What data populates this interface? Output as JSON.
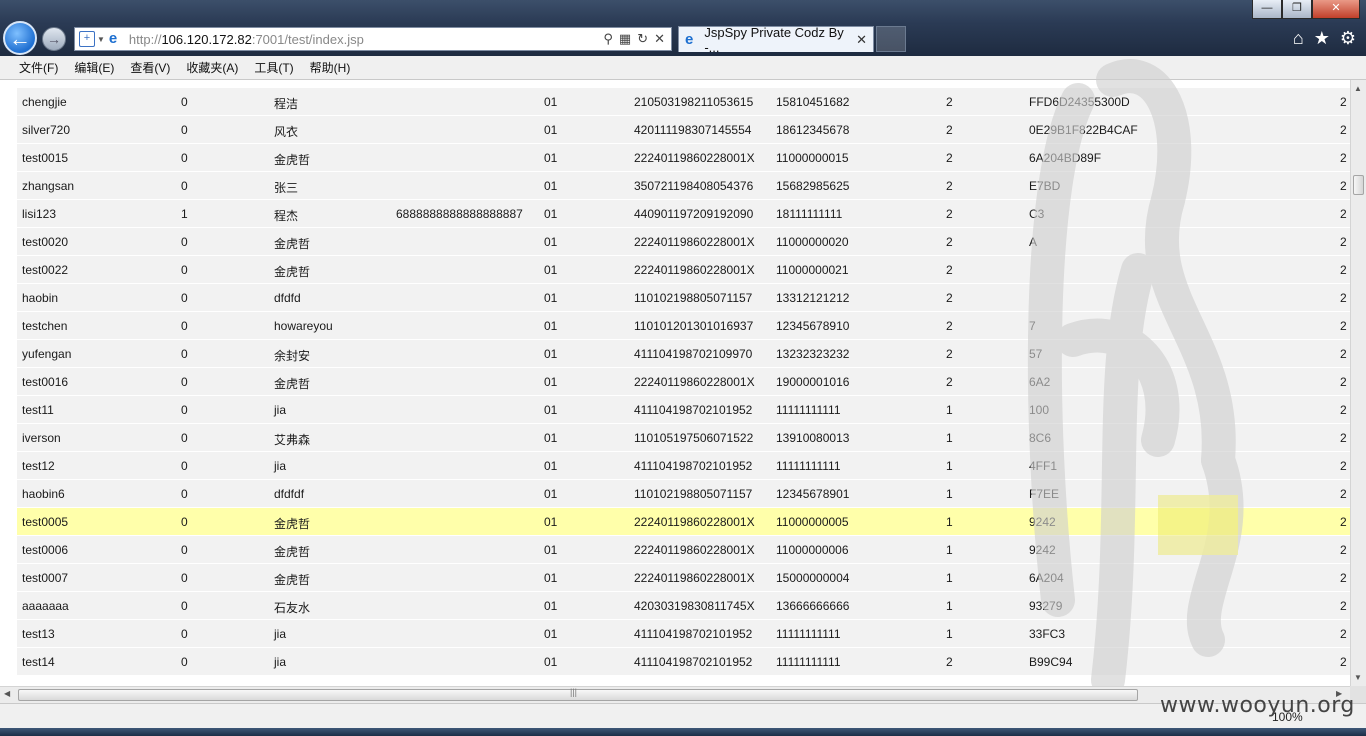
{
  "window": {
    "minimize_label": "—",
    "maximize_label": "❐",
    "close_label": "✕"
  },
  "address_bar": {
    "url_prefix": "http://",
    "url_host": "106.120.172.82",
    "url_rest": ":7001/test/index.jsp"
  },
  "tab": {
    "title": "JspSpy Private Codz By -..."
  },
  "menu": [
    "文件(F)",
    "编辑(E)",
    "查看(V)",
    "收藏夹(A)",
    "工具(T)",
    "帮助(H)"
  ],
  "table": {
    "rows": [
      {
        "user": "chengjie",
        "flag": "0",
        "name": "程洁",
        "extra": "",
        "code": "01",
        "id": "210503198211053615",
        "phone": "15810451682",
        "num": "2",
        "hash": "FFD6D24355300D",
        "last": "2"
      },
      {
        "user": "silver720",
        "flag": "0",
        "name": "风衣",
        "extra": "",
        "code": "01",
        "id": "420111198307145554",
        "phone": "18612345678",
        "num": "2",
        "hash": "0E29B1F822B4CAF",
        "last": "2"
      },
      {
        "user": "test0015",
        "flag": "0",
        "name": "金虎哲",
        "extra": "",
        "code": "01",
        "id": "22240119860228001X",
        "phone": "11000000015",
        "num": "2",
        "hash": "6A204BD89F",
        "last": "2"
      },
      {
        "user": "zhangsan",
        "flag": "0",
        "name": "张三",
        "extra": "",
        "code": "01",
        "id": "350721198408054376",
        "phone": "15682985625",
        "num": "2",
        "hash": "E7BD",
        "last": "2"
      },
      {
        "user": "lisi123",
        "flag": "1",
        "name": "程杰",
        "extra": "6888888888888888887",
        "code": "01",
        "id": "440901197209192090",
        "phone": "18111111111",
        "num": "2",
        "hash": "C3",
        "last": "2"
      },
      {
        "user": "test0020",
        "flag": "0",
        "name": "金虎哲",
        "extra": "",
        "code": "01",
        "id": "22240119860228001X",
        "phone": "11000000020",
        "num": "2",
        "hash": "A",
        "last": "2"
      },
      {
        "user": "test0022",
        "flag": "0",
        "name": "金虎哲",
        "extra": "",
        "code": "01",
        "id": "22240119860228001X",
        "phone": "11000000021",
        "num": "2",
        "hash": "",
        "last": "2"
      },
      {
        "user": "haobin",
        "flag": "0",
        "name": "dfdfd",
        "extra": "",
        "code": "01",
        "id": "110102198805071157",
        "phone": "13312121212",
        "num": "2",
        "hash": "",
        "last": "2"
      },
      {
        "user": "testchen",
        "flag": "0",
        "name": "howareyou",
        "extra": "",
        "code": "01",
        "id": "110101201301016937",
        "phone": "12345678910",
        "num": "2",
        "hash": "7",
        "last": "2"
      },
      {
        "user": "yufengan",
        "flag": "0",
        "name": "余封安",
        "extra": "",
        "code": "01",
        "id": "411104198702109970",
        "phone": "13232323232",
        "num": "2",
        "hash": "57",
        "last": "2"
      },
      {
        "user": "test0016",
        "flag": "0",
        "name": "金虎哲",
        "extra": "",
        "code": "01",
        "id": "22240119860228001X",
        "phone": "19000001016",
        "num": "2",
        "hash": "6A2",
        "last": "2"
      },
      {
        "user": "test11",
        "flag": "0",
        "name": "jia",
        "extra": "",
        "code": "01",
        "id": "411104198702101952",
        "phone": "11111111111",
        "num": "1",
        "hash": "100",
        "last": "2"
      },
      {
        "user": "iverson",
        "flag": "0",
        "name": "艾弗森",
        "extra": "",
        "code": "01",
        "id": "110105197506071522",
        "phone": "13910080013",
        "num": "1",
        "hash": "8C6",
        "last": "2"
      },
      {
        "user": "test12",
        "flag": "0",
        "name": "jia",
        "extra": "",
        "code": "01",
        "id": "411104198702101952",
        "phone": "11111111111",
        "num": "1",
        "hash": "4FF1",
        "last": "2"
      },
      {
        "user": "haobin6",
        "flag": "0",
        "name": "dfdfdf",
        "extra": "",
        "code": "01",
        "id": "110102198805071157",
        "phone": "12345678901",
        "num": "1",
        "hash": "F7EE",
        "last": "2"
      },
      {
        "user": "test0005",
        "flag": "0",
        "name": "金虎哲",
        "extra": "",
        "code": "01",
        "id": "22240119860228001X",
        "phone": "11000000005",
        "num": "1",
        "hash": "9242",
        "last": "2"
      },
      {
        "user": "test0006",
        "flag": "0",
        "name": "金虎哲",
        "extra": "",
        "code": "01",
        "id": "22240119860228001X",
        "phone": "11000000006",
        "num": "1",
        "hash": "9242",
        "last": "2"
      },
      {
        "user": "test0007",
        "flag": "0",
        "name": "金虎哲",
        "extra": "",
        "code": "01",
        "id": "22240119860228001X",
        "phone": "15000000004",
        "num": "1",
        "hash": "6A204",
        "last": "2"
      },
      {
        "user": "aaaaaaa",
        "flag": "0",
        "name": "石友水",
        "extra": "",
        "code": "01",
        "id": "42030319830811745X",
        "phone": "13666666666",
        "num": "1",
        "hash": "93279",
        "last": "2"
      },
      {
        "user": "test13",
        "flag": "0",
        "name": "jia",
        "extra": "",
        "code": "01",
        "id": "411104198702101952",
        "phone": "11111111111",
        "num": "1",
        "hash": "33FC3",
        "last": "2"
      },
      {
        "user": "test14",
        "flag": "0",
        "name": "jia",
        "extra": "",
        "code": "01",
        "id": "411104198702101952",
        "phone": "11111111111",
        "num": "2",
        "hash": "B99C94",
        "last": "2"
      }
    ],
    "highlight_user": "test0005"
  },
  "status": {
    "zoom": "100%"
  },
  "watermark": "www.wooyun.org",
  "colors": {
    "row_bg": "#f2f2f2",
    "row_highlight": "#ffffaa",
    "chrome_dark": "#2b3b55"
  }
}
